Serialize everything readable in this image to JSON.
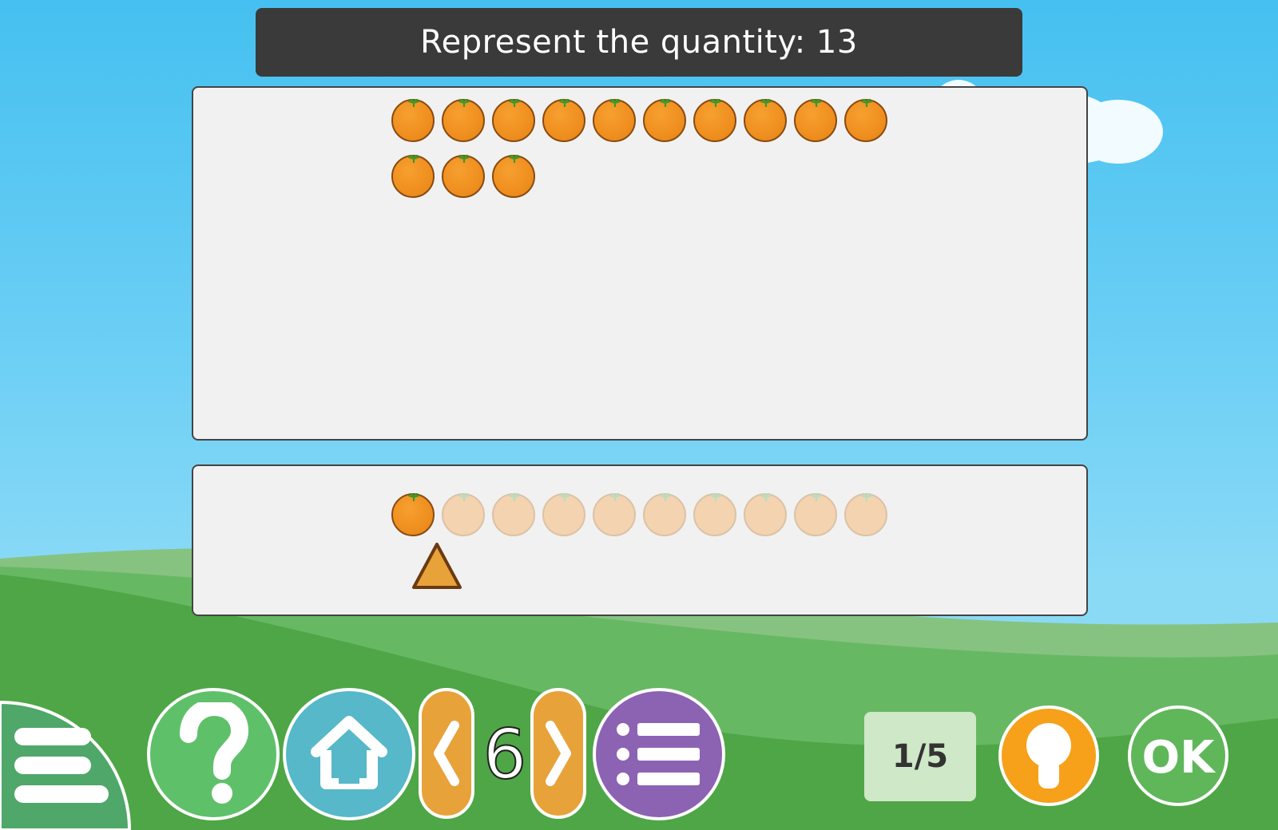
{
  "title": {
    "prefix": "Represent the quantity:",
    "quantity": "13",
    "text": "Represent the quantity: 13"
  },
  "target_count": 13,
  "selector": {
    "slots": 10,
    "selected": 1
  },
  "level": "6",
  "progress": "1/5",
  "buttons": {
    "menu": "menu-icon",
    "help": "question-mark-icon",
    "home": "home-icon",
    "prev": "chevron-left-icon",
    "next": "chevron-right-icon",
    "list": "list-icon",
    "hint": "lightbulb-icon",
    "ok": "OK"
  },
  "colors": {
    "orange": "#f09020",
    "help": "#5fc06a",
    "home": "#56b8c9",
    "arrows": "#e8a23a",
    "list": "#8c63b2",
    "hint": "#f7a01a",
    "ok": "#5fb75a"
  }
}
